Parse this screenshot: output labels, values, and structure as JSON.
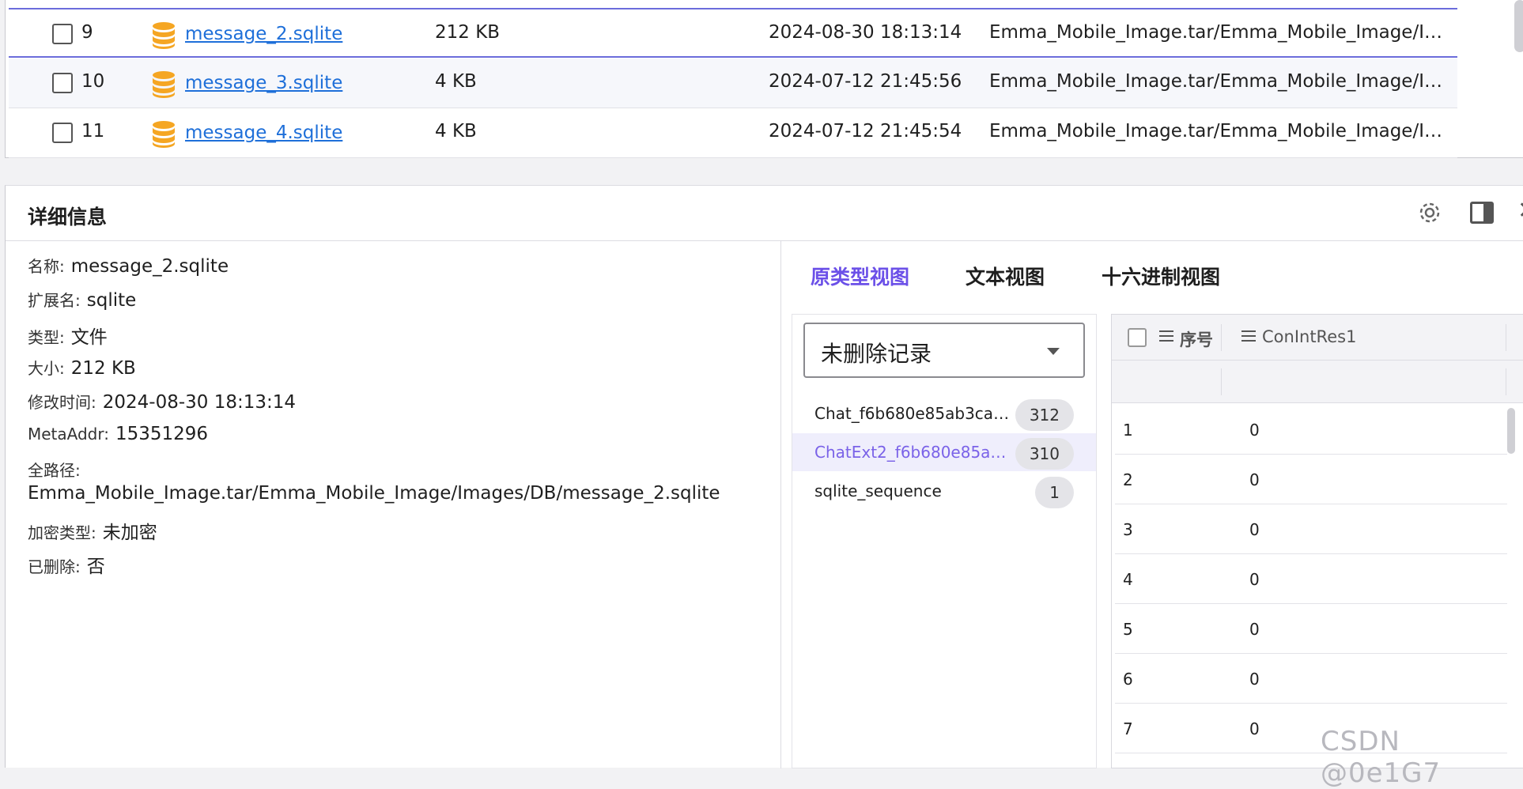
{
  "files": [
    {
      "index": "9",
      "name": "message_2.sqlite",
      "size": "212 KB",
      "date": "2024-08-30 18:13:14",
      "path": "Emma_Mobile_Image.tar/Emma_Mobile_Image/Ima..."
    },
    {
      "index": "10",
      "name": "message_3.sqlite",
      "size": "4 KB",
      "date": "2024-07-12 21:45:56",
      "path": "Emma_Mobile_Image.tar/Emma_Mobile_Image/Ima..."
    },
    {
      "index": "11",
      "name": "message_4.sqlite",
      "size": "4 KB",
      "date": "2024-07-12 21:45:54",
      "path": "Emma_Mobile_Image.tar/Emma_Mobile_Image/Ima..."
    }
  ],
  "detail": {
    "title": "详细信息",
    "props": [
      {
        "key": "名称:",
        "value": "message_2.sqlite"
      },
      {
        "key": "扩展名:",
        "value": "sqlite"
      },
      {
        "key": "类型:",
        "value": "文件"
      },
      {
        "key": "大小:",
        "value": "212 KB"
      },
      {
        "key": "修改时间:",
        "value": "2024-08-30 18:13:14"
      },
      {
        "key": "MetaAddr:",
        "value": "15351296"
      },
      {
        "key": "全路径:",
        "value": ""
      },
      {
        "key": "",
        "value": "Emma_Mobile_Image.tar/Emma_Mobile_Image/Images/DB/message_2.sqlite"
      },
      {
        "key": "加密类型:",
        "value": "未加密"
      },
      {
        "key": "已删除:",
        "value": "否"
      }
    ]
  },
  "tabs": [
    "原类型视图",
    "文本视图",
    "十六进制视图"
  ],
  "record_filter": "未删除记录",
  "tables": [
    {
      "name": "Chat_f6b680e85ab3ca2...",
      "count": "312"
    },
    {
      "name": "ChatExt2_f6b680e85ab...",
      "count": "310"
    },
    {
      "name": "sqlite_sequence",
      "count": "1"
    }
  ],
  "grid": {
    "headers": [
      "序号",
      "ConIntRes1"
    ],
    "rows": [
      [
        "1",
        "0"
      ],
      [
        "2",
        "0"
      ],
      [
        "3",
        "0"
      ],
      [
        "4",
        "0"
      ],
      [
        "5",
        "0"
      ],
      [
        "6",
        "0"
      ],
      [
        "7",
        "0"
      ]
    ]
  },
  "watermark": "CSDN @0e1G7",
  "colors": {
    "accent": "#6b50e8",
    "link": "#1e6fd9",
    "db_icon": "#f5a623"
  }
}
